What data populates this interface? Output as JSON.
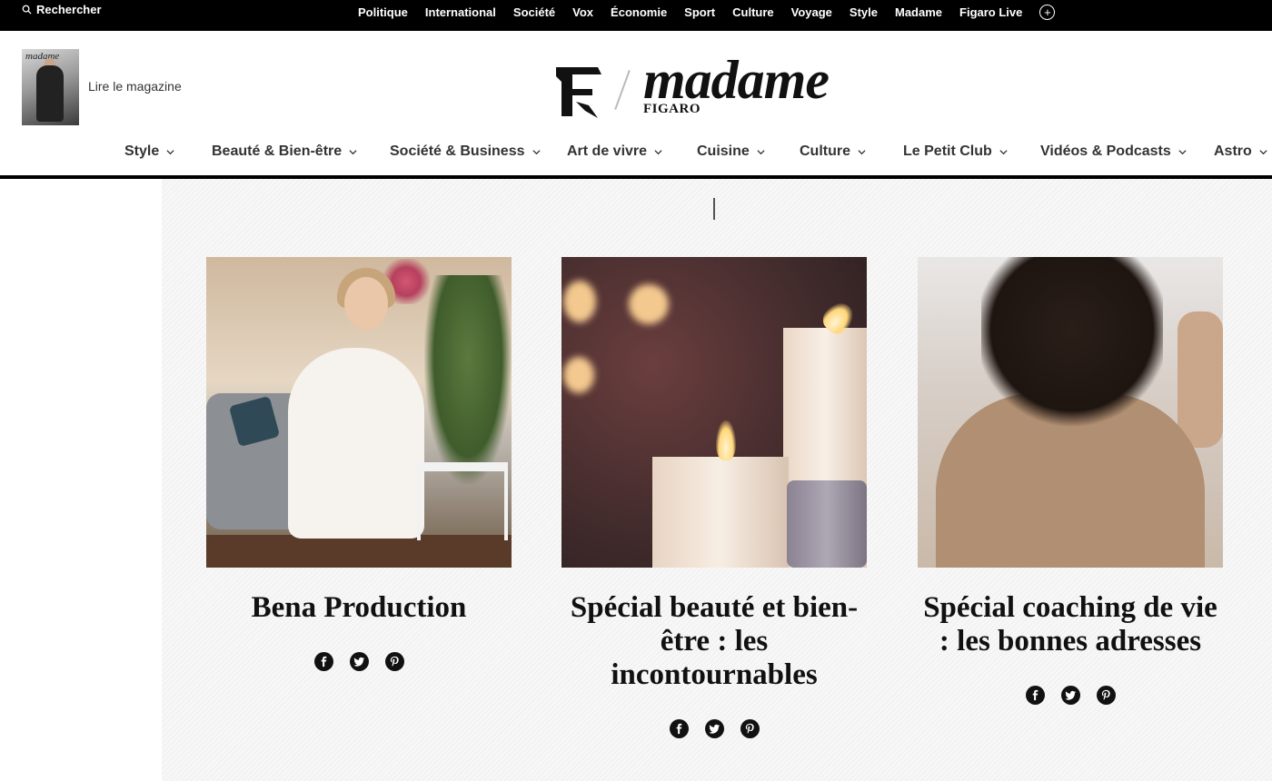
{
  "search": {
    "label": "Rechercher"
  },
  "topnav": {
    "items": [
      "Politique",
      "International",
      "Société",
      "Vox",
      "Économie",
      "Sport",
      "Culture",
      "Voyage",
      "Style",
      "Madame",
      "Figaro Live"
    ]
  },
  "header": {
    "magazine_cover_mast": "madame",
    "magazine_link": "Lire le magazine",
    "logo_word": "madame",
    "logo_sub": "FIGARO"
  },
  "sections": {
    "items": [
      "Style",
      "Beauté & Bien-être",
      "Société & Business",
      "Art de vivre",
      "Cuisine",
      "Culture",
      "Le Petit Club",
      "Vidéos & Podcasts",
      "Astro"
    ]
  },
  "cards": [
    {
      "title": "Bena Production"
    },
    {
      "title": "Spécial beauté et bien-être : les incontournables"
    },
    {
      "title": "Spécial coaching de vie : les bonnes adresses"
    }
  ],
  "icons": {
    "share": [
      "facebook-icon",
      "twitter-icon",
      "pinterest-icon"
    ]
  }
}
